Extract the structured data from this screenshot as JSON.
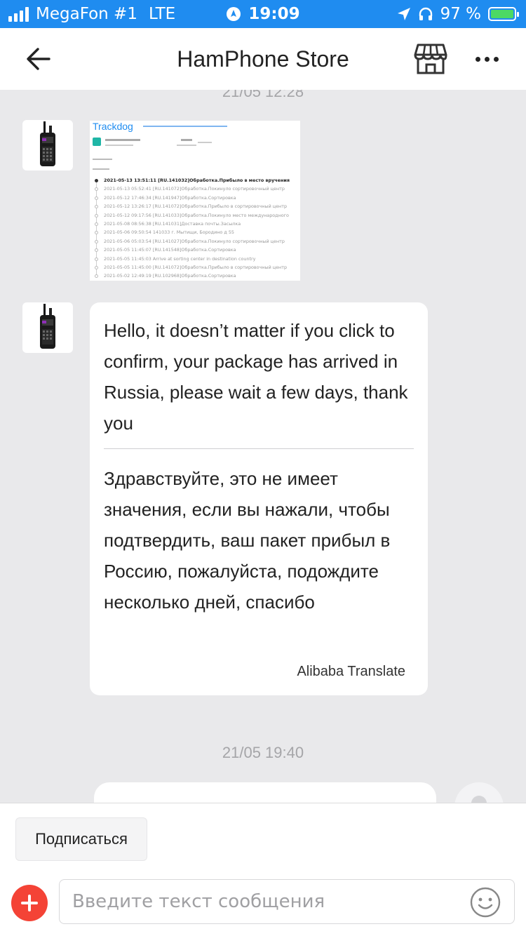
{
  "status_bar": {
    "carrier": "MegaFon #1",
    "network": "LTE",
    "time": "19:09",
    "battery": "97 %"
  },
  "header": {
    "title": "HamPhone Store"
  },
  "chat": {
    "timestamp_top": "21/05 12:28",
    "image_message": {
      "brand": "Trackdog",
      "tracking_lines": [
        "2021-05-13 13:51:11  [RU.141032]Обработка.Прибыло в место вручения",
        "2021-05-13 05:52:41  [RU.141072]Обработка.Покинуло сортировочный центр",
        "2021-05-12 17:46:34  [RU.141947]Обработка.Сортировка",
        "2021-05-12 13:26:17  [RU.141072]Обработка.Прибыло в сортировочный центр",
        "2021-05-12 09:17:56  [RU.141033]Обработка.Покинуло место международного",
        "2021-05-08 08:56:38  [RU.141031]Доставка почты.Засылка",
        "2021-05-06 09:50:54  141033 г. Мытищи, Бородино д 55",
        "2021-05-06 05:03:54  [RU.141027]Обработка.Покинуло сортировочный центр",
        "2021-05-05 11:45:07  [RU.141548]Обработка.Сортировка",
        "2021-05-05 11:45:03  Arrive at sorting center in destination country",
        "2021-05-05 11:45:00  [RU.141072]Обработка.Прибыло в сортировочный центр",
        "2021-05-02 12:49:19  [RU.102968]Обработка.Сортировка"
      ]
    },
    "text_message": {
      "original": "Hello, it doesn’t matter if you click to confirm, your package has arrived in Russia, please wait a few days, thank you",
      "translated": "Здравствуйте, это не имеет значения, если вы нажали, чтобы подтвердить, ваш пакет прибыл в Россию, пожалуйста, подождите несколько дней, спасибо",
      "credit": "Alibaba Translate"
    },
    "timestamp_bottom": "21/05 19:40"
  },
  "footer": {
    "subscribe_label": "Подписаться",
    "input_placeholder": "Введите текст сообщения",
    "input_value": ""
  },
  "colors": {
    "status_bar_bg": "#1f8cf0",
    "chat_bg": "#e9e9eb",
    "accent_red": "#f44336"
  },
  "icons": [
    "signal-icon",
    "alarm-icon",
    "location-arrow-icon",
    "headphones-icon",
    "battery-icon",
    "back-arrow-icon",
    "store-icon",
    "more-icon",
    "plus-icon",
    "emoji-icon"
  ]
}
